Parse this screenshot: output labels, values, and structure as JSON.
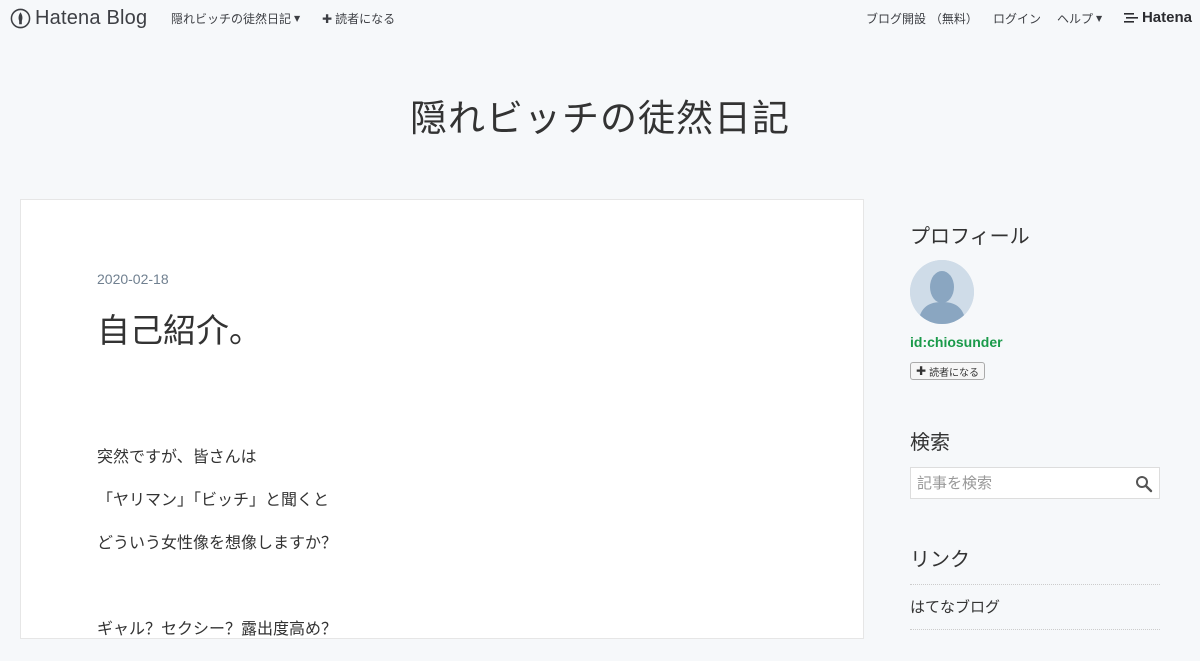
{
  "globalbar": {
    "brand": "Hatena Blog",
    "blog_menu": "隠れビッチの徒然日記",
    "subscribe": "読者になる",
    "signup": "ブログ開設 （無料）",
    "login": "ログイン",
    "help": "ヘルプ",
    "hatena": "Hatena"
  },
  "blog": {
    "title": "隠れビッチの徒然日記"
  },
  "entry": {
    "date": "2020-02-18",
    "title": "自己紹介。",
    "paragraphs": [
      "突然ですが、皆さんは",
      "「ヤリマン」「ビッチ」と聞くと",
      "どういう女性像を想像しますか？",
      "",
      "ギャル？セクシー？露出度高め？"
    ]
  },
  "sidebar": {
    "profile_heading": "プロフィール",
    "profile_id": "id:chiosunder",
    "subscribe_button": "読者になる",
    "search_heading": "検索",
    "search_placeholder": "記事を検索",
    "links_heading": "リンク",
    "links": [
      "はてなブログ"
    ]
  },
  "colors": {
    "background": "#f6f8fa",
    "profile_id": "#1a9a4a",
    "date": "#708090"
  }
}
